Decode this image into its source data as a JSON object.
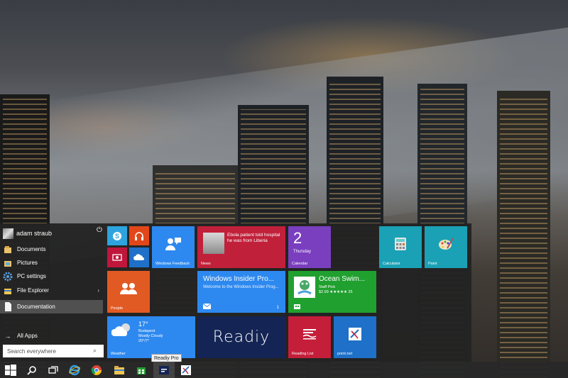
{
  "user": {
    "name": "adam straub"
  },
  "start_left": {
    "items": [
      {
        "label": "Documents",
        "icon": "documents-folder-icon"
      },
      {
        "label": "Pictures",
        "icon": "pictures-folder-icon"
      },
      {
        "label": "PC settings",
        "icon": "gear-icon"
      },
      {
        "label": "File Explorer",
        "icon": "file-explorer-icon",
        "has_submenu": true
      },
      {
        "label": "Documentation",
        "icon": "document-icon",
        "selected": true
      }
    ],
    "all_apps_label": "All Apps",
    "search_placeholder": "Search everywhere"
  },
  "tiles": {
    "windows_feedback": "Windows Feedback",
    "news": {
      "label": "News",
      "headline": "Ebola patient told hospital he was from Liberia"
    },
    "calendar": {
      "label": "Calendar",
      "day_number": "2",
      "day_name": "Thursday"
    },
    "calculator": "Calculator",
    "paint": "Paint",
    "people": "People",
    "insider": {
      "title": "Windows Insider Pro...",
      "subtitle": "Welcome to the Windows Insider Prog...",
      "badge": "1"
    },
    "store": {
      "app_name": "Ocean Swim...",
      "pick": "Staff Pick",
      "price_rating": "$2.99 ★★★★★ 25"
    },
    "weather": {
      "label": "Weather",
      "temp": "17°",
      "city": "Budapest",
      "condition": "Mostly Cloudy",
      "range": "20°/7°"
    },
    "readiy": {
      "logo_text": "Readiy"
    },
    "reading_list": "Reading List",
    "pointnet": "point.net"
  },
  "taskbar": {
    "tooltip": "Readiy Pro"
  },
  "colors": {
    "start_bg": "#232323",
    "accent_blue": "#2d89ef",
    "news_red": "#c1203a",
    "calendar_purple": "#7a3fbf",
    "teal": "#1aa1b5",
    "people_orange": "#e25a23",
    "store_green": "#20a02f",
    "readiy_navy": "#142454",
    "reading_red": "#c41e3a"
  }
}
